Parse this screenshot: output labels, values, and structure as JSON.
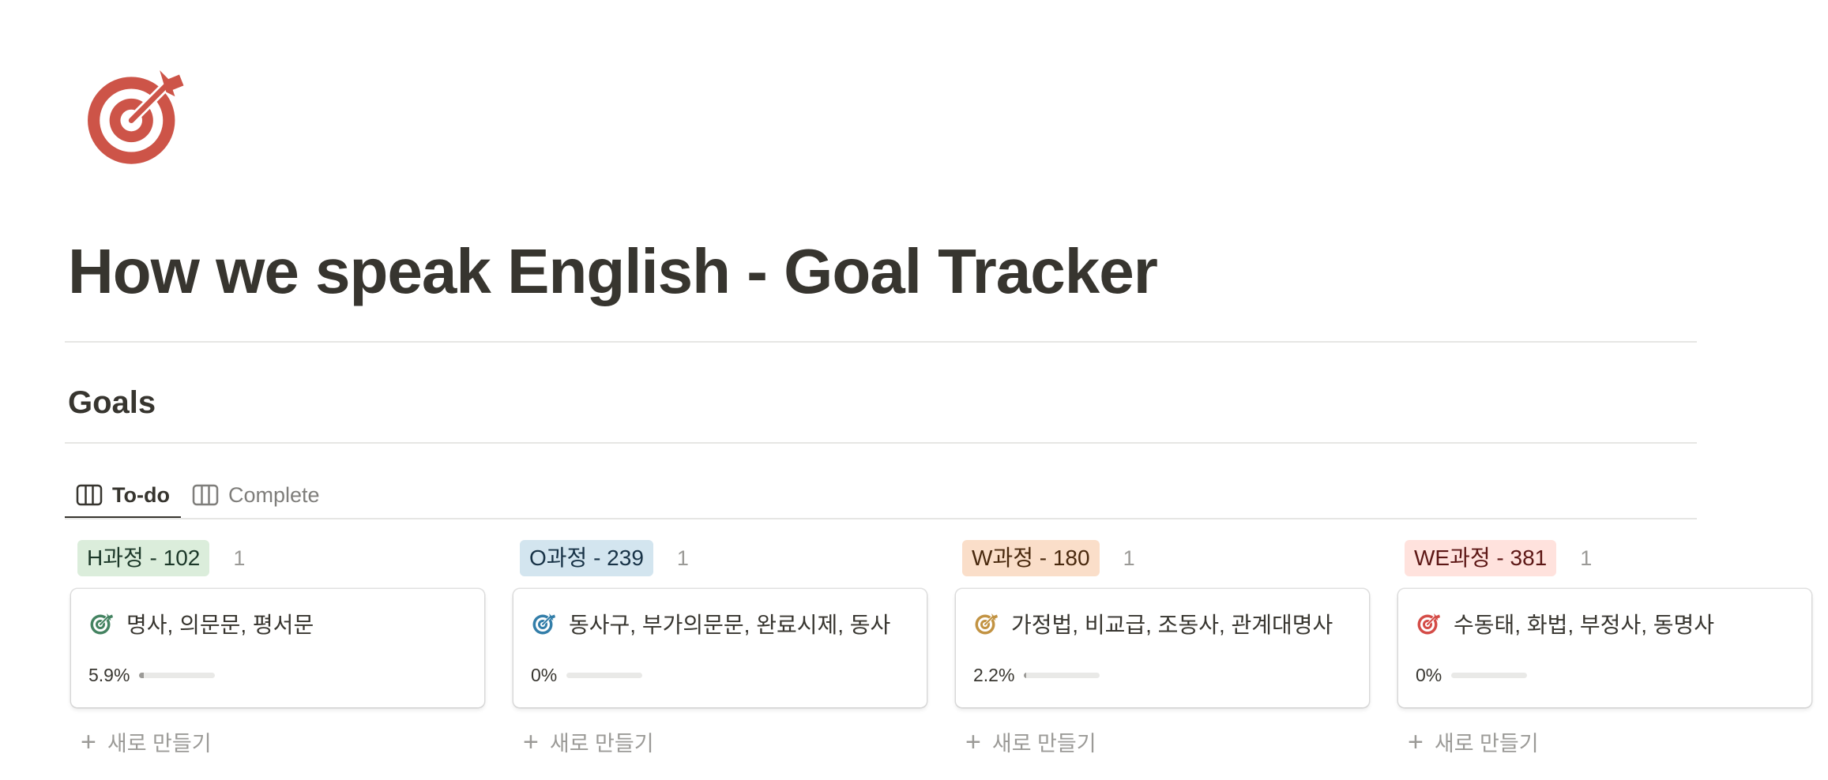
{
  "page": {
    "title": "How we speak English - Goal Tracker",
    "icon": "target-icon",
    "icon_color": "#cd5448"
  },
  "section": {
    "title": "Goals"
  },
  "tabs": [
    {
      "label": "To-do",
      "icon": "board-icon",
      "active": true
    },
    {
      "label": "Complete",
      "icon": "board-icon",
      "active": false
    }
  ],
  "columns": [
    {
      "tag": "H과정 - 102",
      "tag_bg": "#dbeddb",
      "tag_color": "#1c3829",
      "count": "1",
      "card": {
        "title": "명사, 의문문, 평서문",
        "icon_color": "#448361",
        "progress_text": "5.9%",
        "progress": 0.059
      },
      "new_label": "새로 만들기"
    },
    {
      "tag": "O과정 - 239",
      "tag_bg": "#d3e5ef",
      "tag_color": "#183347",
      "count": "1",
      "card": {
        "title": "동사구, 부가의문문, 완료시제, 동사",
        "icon_color": "#337ea9",
        "progress_text": "0%",
        "progress": 0.0
      },
      "new_label": "새로 만들기"
    },
    {
      "tag": "W과정 - 180",
      "tag_bg": "#fadec9",
      "tag_color": "#49290e",
      "count": "1",
      "card": {
        "title": "가정법, 비교급, 조동사, 관계대명사",
        "icon_color": "#c29343",
        "progress_text": "2.2%",
        "progress": 0.022
      },
      "new_label": "새로 만들기"
    },
    {
      "tag": "WE과정 - 381",
      "tag_bg": "#ffe2dd",
      "tag_color": "#5d1715",
      "count": "1",
      "card": {
        "title": "수동태, 화법, 부정사, 동명사",
        "icon_color": "#d44c47",
        "progress_text": "0%",
        "progress": 0.0
      },
      "new_label": "새로 만들기"
    }
  ]
}
